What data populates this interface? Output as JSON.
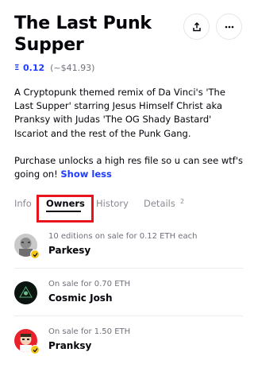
{
  "header": {
    "title": "The Last Punk Supper"
  },
  "price": {
    "eth_icon": "Ξ",
    "eth_amount": "0.12",
    "usd_amount": "(~$41.93)"
  },
  "description": {
    "paragraph1": "A Cryptopunk themed remix of Da Vinci's 'The Last Supper' starring Jesus Himself Christ aka Pranksy with Judas 'The OG Shady Bastard' Iscariot and the rest of the Punk Gang.",
    "paragraph2": "Purchase unlocks a high res file so u can see wtf's going on!",
    "show_less": "Show less"
  },
  "tabs": {
    "info": "Info",
    "owners": "Owners",
    "history": "History",
    "details": "Details",
    "details_count": "2"
  },
  "owners": [
    {
      "sale_text": "10 editions on sale for 0.12 ETH each",
      "name": "Parkesy",
      "verified": true
    },
    {
      "sale_text": "On sale for 0.70 ETH",
      "name": "Cosmic Josh",
      "verified": false
    },
    {
      "sale_text": "On sale for 1.50 ETH",
      "name": "Pranksy",
      "verified": true
    }
  ],
  "colors": {
    "accent": "#1f3cff",
    "highlight": "#e8131f",
    "badge": "#f5c518"
  }
}
